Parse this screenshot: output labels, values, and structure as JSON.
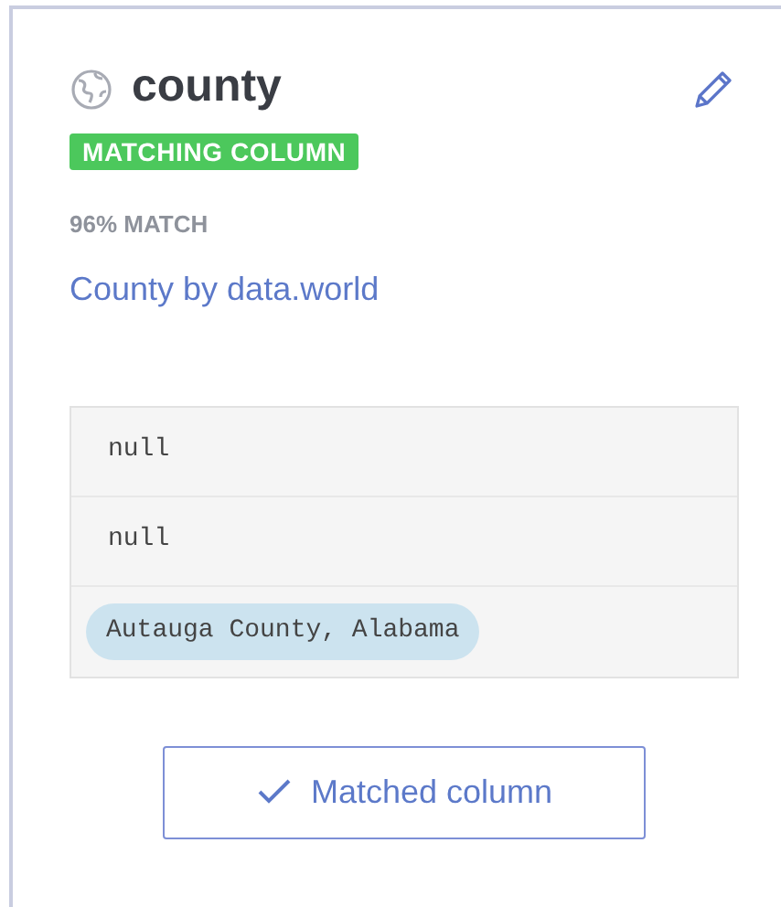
{
  "card": {
    "title": "county",
    "badge": "MATCHING COLUMN",
    "match": "96% MATCH",
    "link": "County by data.world",
    "values": [
      {
        "text": "null",
        "highlighted": false
      },
      {
        "text": "null",
        "highlighted": false
      },
      {
        "text": "Autauga County, Alabama",
        "highlighted": true
      }
    ],
    "button": "Matched column"
  }
}
